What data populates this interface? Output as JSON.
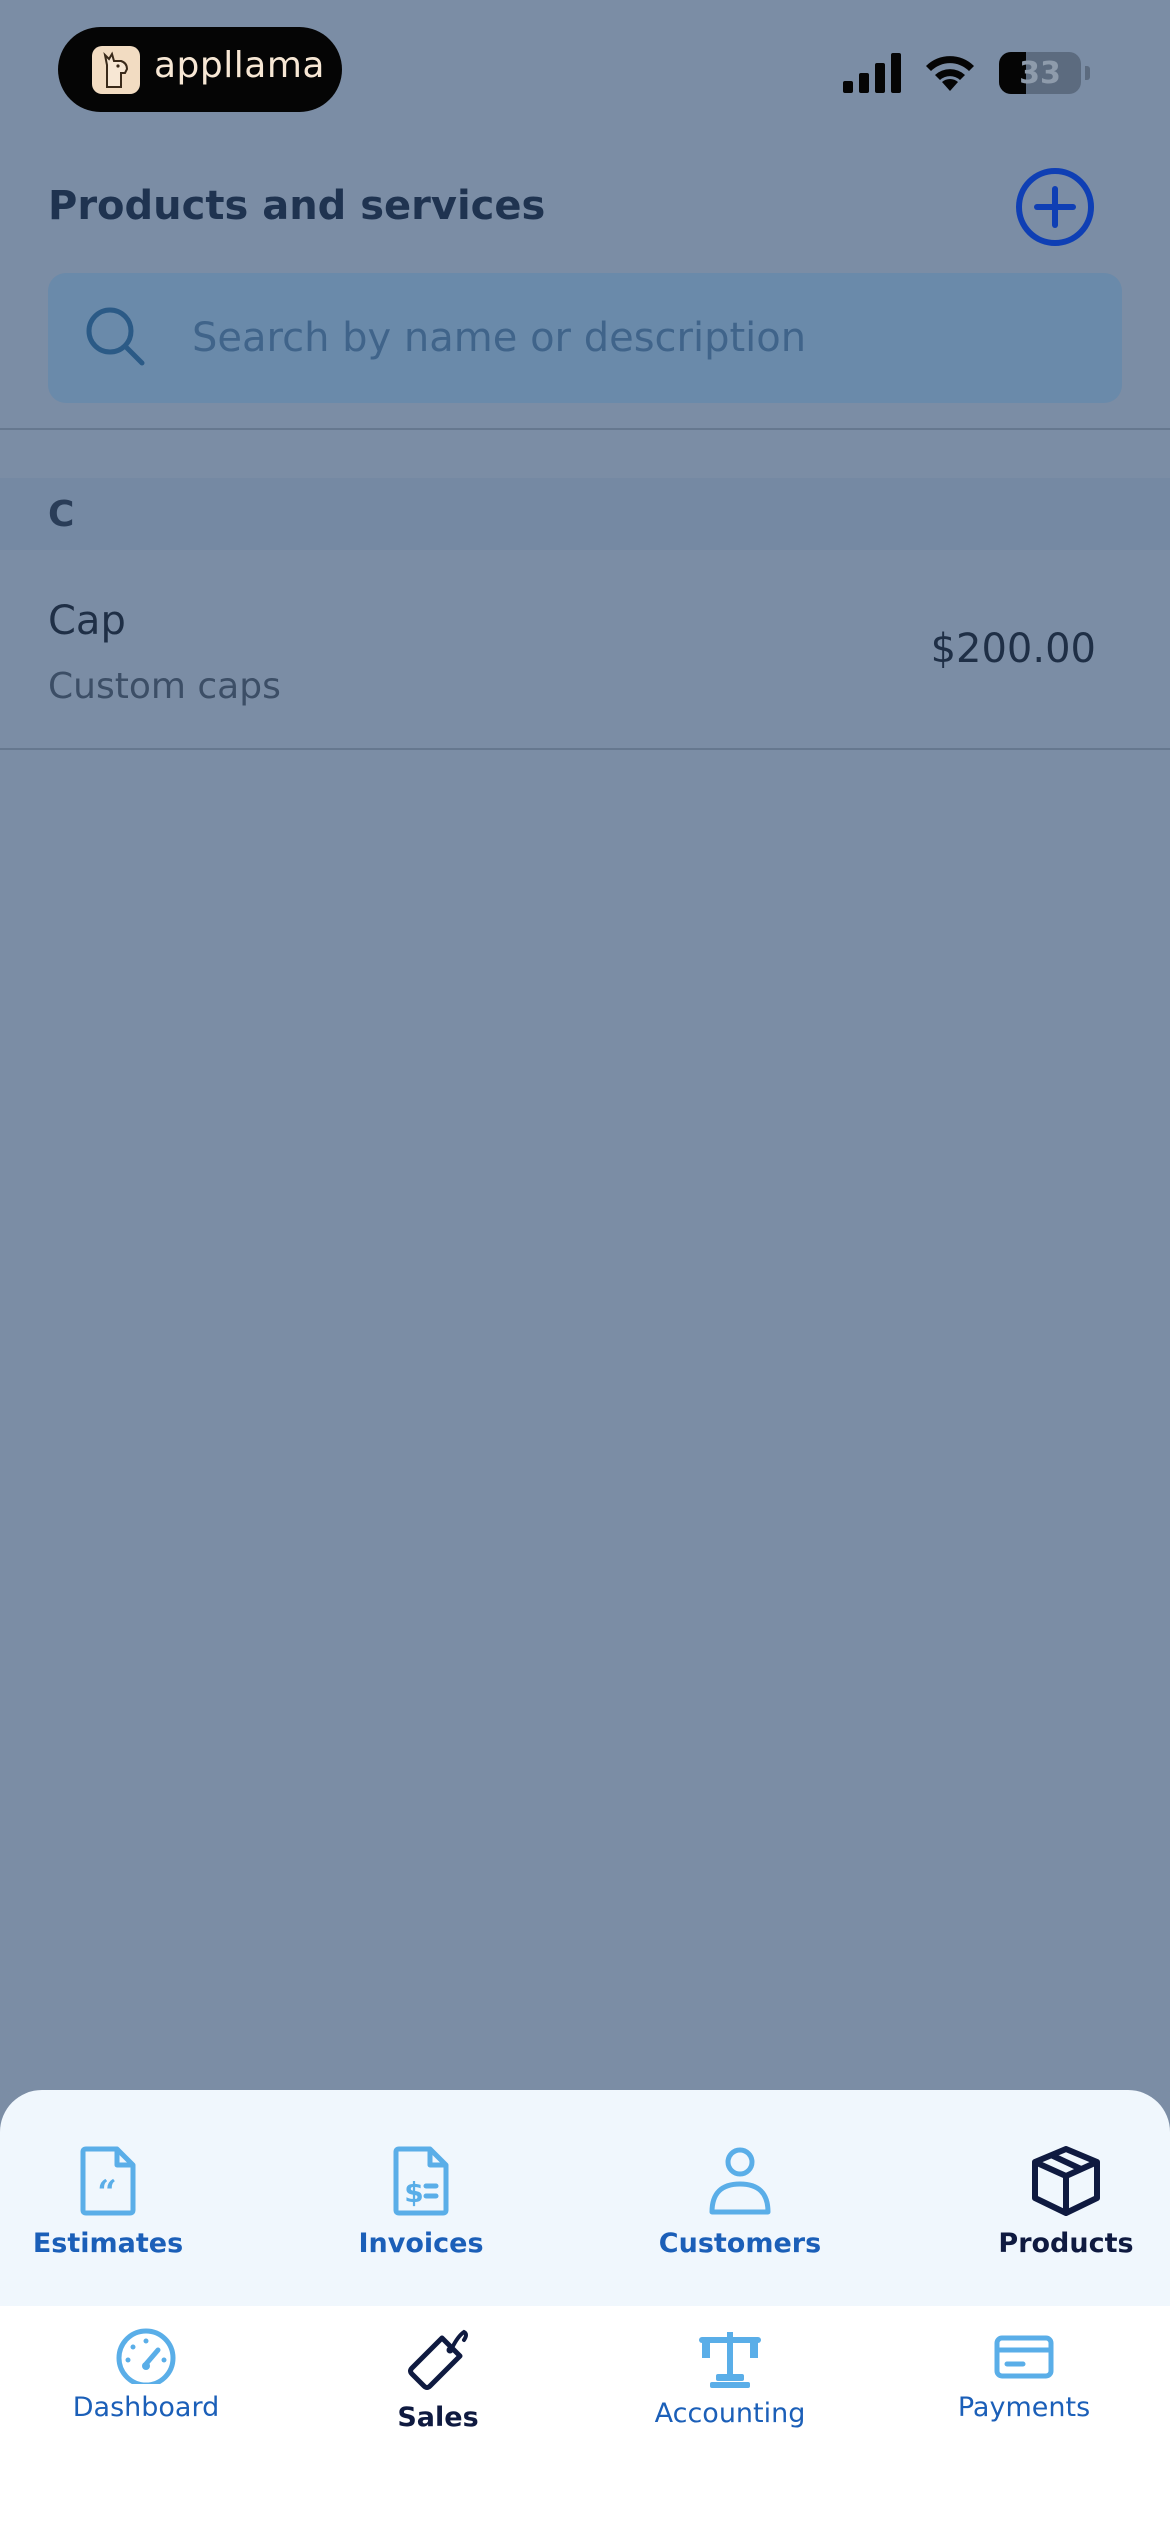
{
  "status_bar": {
    "app_badge_text": "appllama",
    "battery_percent": "33",
    "battery_level": 0.33
  },
  "header": {
    "title": "Products and services",
    "add_icon": "plus-circle-icon"
  },
  "search": {
    "placeholder": "Search by name or description",
    "value": ""
  },
  "sections": [
    {
      "letter": "C",
      "items": [
        {
          "name": "Cap",
          "description": "Custom caps",
          "price": "$200.00"
        }
      ]
    }
  ],
  "sub_tabs": [
    {
      "label": "Estimates",
      "icon": "estimate-document-icon",
      "active": false
    },
    {
      "label": "Invoices",
      "icon": "invoice-dollar-icon",
      "active": false
    },
    {
      "label": "Customers",
      "icon": "person-icon",
      "active": false
    },
    {
      "label": "Products",
      "icon": "box-icon",
      "active": true
    }
  ],
  "main_nav": [
    {
      "label": "Dashboard",
      "icon": "speedometer-icon",
      "active": false
    },
    {
      "label": "Sales",
      "icon": "price-tag-icon",
      "active": true
    },
    {
      "label": "Accounting",
      "icon": "scales-icon",
      "active": false
    },
    {
      "label": "Payments",
      "icon": "credit-card-icon",
      "active": false
    }
  ],
  "colors": {
    "accent": "#0f3fb4",
    "icon_light_blue": "#5aaee8",
    "active_dark": "#0f1a40",
    "label_blue": "#1b5fb8"
  }
}
